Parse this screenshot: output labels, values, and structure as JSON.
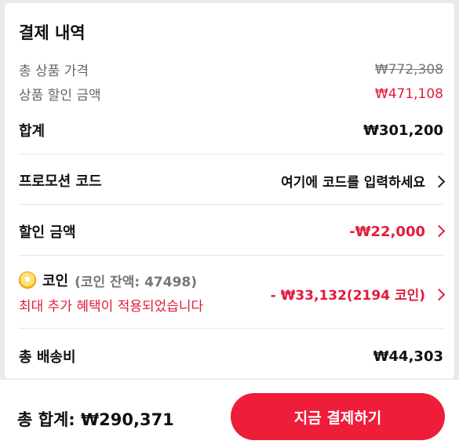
{
  "section_title": "결제 내역",
  "summary": {
    "total_label": "총 상품 가격",
    "total_value": "₩772,308",
    "discount_label": "상품 할인 금액",
    "discount_value": "₩471,108",
    "subtotal_label": "합계",
    "subtotal_value": "₩301,200"
  },
  "promo": {
    "label": "프로모션 코드",
    "placeholder": "여기에 코드를 입력하세요"
  },
  "discount_amount": {
    "label": "할인 금액",
    "value": "-₩22,000"
  },
  "coin": {
    "icon": "coin-icon",
    "label": "코인",
    "balance": "(코인 잔액: 47498)",
    "benefit_note": "최대 추가 혜택이 적용되었습니다",
    "value": "- ₩33,132(2194 코인)"
  },
  "shipping": {
    "label": "총 배송비",
    "value": "₩44,303"
  },
  "footer": {
    "grand_total": "총 합계:  ₩290,371",
    "pay_button": "지금 결제하기"
  },
  "colors": {
    "accent": "#ee1d3a"
  }
}
